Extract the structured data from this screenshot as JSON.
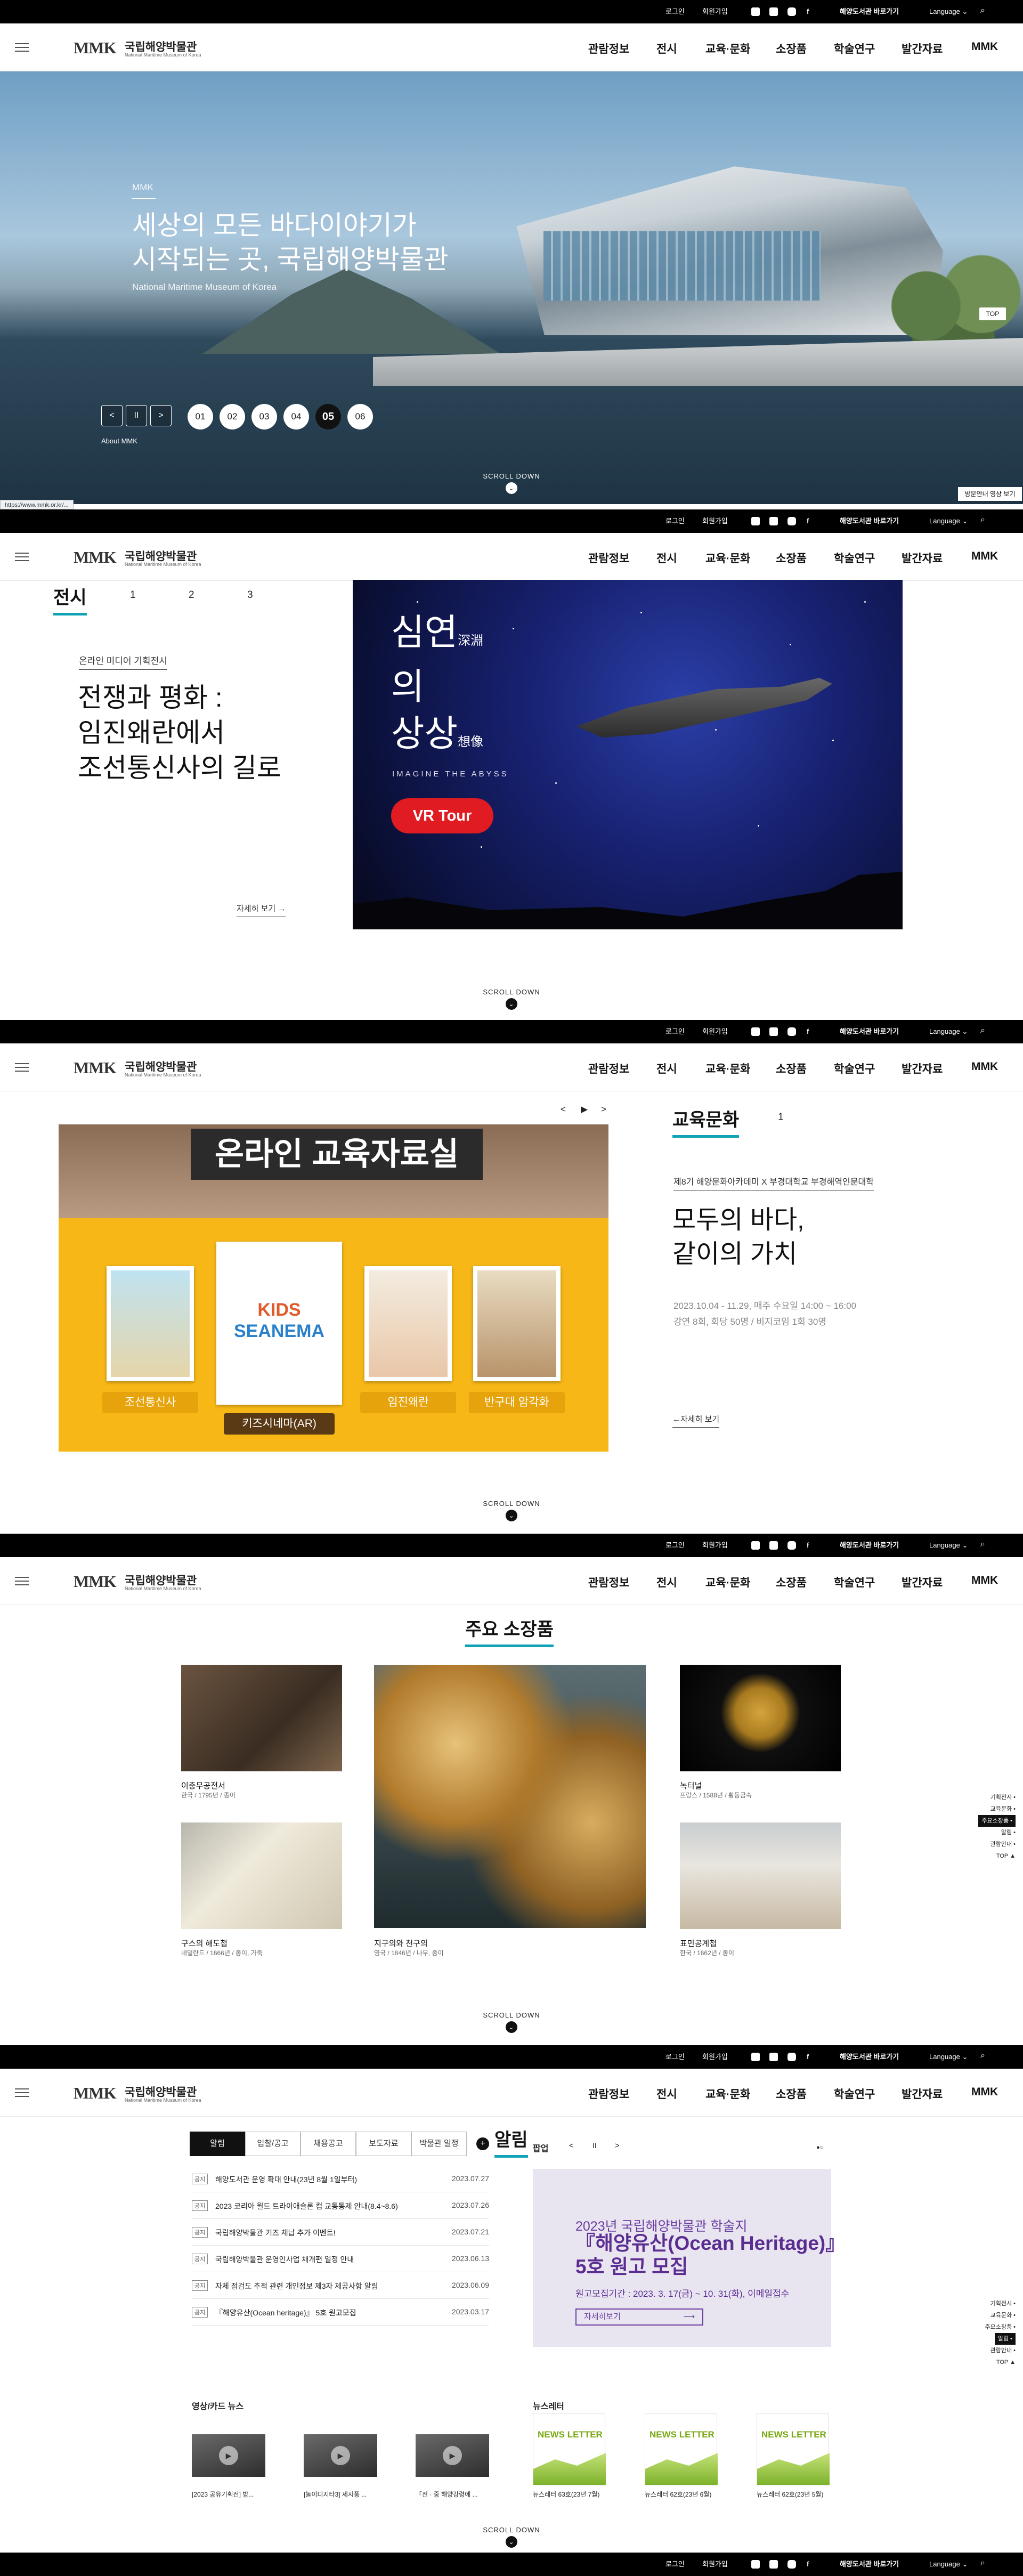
{
  "topbar": {
    "login": "로그인",
    "join": "회원가입",
    "library": "해양도서관 바로가기",
    "language": "Language"
  },
  "logo": {
    "mark": "MMK",
    "name_kr": "국립해양박물관",
    "name_en": "National Maritime Museum of Korea"
  },
  "menu": [
    "관람정보",
    "전시",
    "교육·문화",
    "소장품",
    "학술연구",
    "발간자료",
    "MMK"
  ],
  "hero": {
    "label": "MMK",
    "title_line1": "세상의 모든 바다이야기가",
    "title_line2": "시작되는 곳, 국립해양박물관",
    "subtitle": "National Maritime Museum of Korea",
    "prev": "<",
    "pause": "II",
    "next": ">",
    "slides": [
      "01",
      "02",
      "03",
      "04",
      "05",
      "06"
    ],
    "active_slide": "05",
    "about": "About MMK",
    "top": "TOP",
    "download": "방문안내 영상 보기",
    "status_url": "https://www.mmk.or.kr/..."
  },
  "scroll_down": "SCROLL DOWN",
  "exhibition": {
    "title": "전시",
    "tabs": [
      "1",
      "2",
      "3"
    ],
    "category": "온라인 미디어 기획전시",
    "title_line1": "전쟁과 평화 :",
    "title_line2": "임진왜란에서",
    "title_line3": "조선통신사의 길로",
    "more": "자세히 보기 →",
    "slider_prev": "<",
    "slider_play": "▶",
    "slider_next": ">",
    "poster_line1": "심연",
    "poster_hanja1": "深淵",
    "poster_line2": "의",
    "poster_line3": "상상",
    "poster_hanja2": "想像",
    "poster_en": "IMAGINE THE ABYSS",
    "vr_button": "VR Tour"
  },
  "education": {
    "title": "교육문화",
    "tab": "1",
    "slider_prev": "<",
    "slider_play": "▶",
    "slider_next": ">",
    "banner_title": "온라인 교육자료실",
    "banner_buttons": [
      "조선통신사",
      "키즈시네마(AR)",
      "임진왜란",
      "반구대 암각화"
    ],
    "kids_logo_line1": "KIDS",
    "kids_logo_line2": "SEANEMA",
    "category": "제8기 해양문화아카데미 X 부경대학교 부경해역인문대학",
    "title_line1": "모두의 바다,",
    "title_line2": "같이의 가치",
    "date": "2023.10.04 - 11.29, 매주 수요일 14:00 ~ 16:00",
    "detail": "강연 8회, 회당 50명 / 비지코임 1회 30명",
    "more": "←자세히 보기"
  },
  "collection": {
    "title": "주요 소장품",
    "items": [
      {
        "name": "이충무공전서",
        "desc": "한국 / 1795년 / 종이"
      },
      {
        "name": "구스의 해도첩",
        "desc": "네덜란드 / 1666년 / 종이, 가죽"
      },
      {
        "name": "지구의와 천구의",
        "desc": "영국 / 1846년 / 나무, 종이"
      },
      {
        "name": "녹터널",
        "desc": "프랑스 / 1588년 / 황동금속"
      },
      {
        "name": "표민공계첩",
        "desc": "한국 / 1662년 / 종이"
      }
    ]
  },
  "quick_nav": [
    "기획전시",
    "교육문화",
    "주요소장품",
    "알림",
    "관람안내",
    "TOP"
  ],
  "notice": {
    "title": "알림",
    "tabs": [
      "알림",
      "입찰/공고",
      "채용공고",
      "보도자료",
      "박물관 일정"
    ],
    "more": "+",
    "items": [
      {
        "tag": "공지",
        "text": "해양도서관 운영 확대 안내(23년 8월 1일부터)",
        "date": "2023.07.27"
      },
      {
        "tag": "공지",
        "text": "2023 코리아 월드 트라이애슬론 컵 교통통제 안내(8.4~8.6)",
        "date": "2023.07.26"
      },
      {
        "tag": "공지",
        "text": "국립해양박물관 키즈 체납 추가 이벤트!",
        "date": "2023.07.21"
      },
      {
        "tag": "공지",
        "text": "국립해양박물관 운영인사업 채개편 일정 안내",
        "date": "2023.06.13"
      },
      {
        "tag": "공지",
        "text": "자체 점검도 추적 관련 개인정보 제3자 제공사항 알림",
        "date": "2023.06.09"
      },
      {
        "tag": "공지",
        "text": "『해양유산(Ocean heritage)』 5호 원고모집",
        "date": "2023.03.17"
      }
    ],
    "popup_title": "팝업",
    "popup_prev": "<",
    "popup_pause": "II",
    "popup_next": ">",
    "popup_line1": "2023년 국립해양박물관 학술지",
    "popup_line2": "『해양유산(Ocean Heritage)』",
    "popup_line3": "5호 원고 모집",
    "popup_period": "원고모집기간 : 2023. 3. 17(금) ~ 10. 31(화), 이메일접수",
    "popup_button": "자세히보기",
    "video_title": "영상/카드 뉴스",
    "videos": [
      "[2023 공유기획전] 방...",
      "[놀이디지타3] 세시풍 ...",
      "「전 · 중 해양강령에 ..."
    ],
    "newsletter_title": "뉴스레터",
    "newsletter_label": "NEWS LETTER",
    "newsletters": [
      "뉴스레터 63호(23년 7월)",
      "뉴스레터 62호(23년 6월)",
      "뉴스레터 62호(23년 5월)"
    ]
  },
  "colors": {
    "accent": "#0fa3b5",
    "dark": "#111111",
    "popup_purple": "#5b2d91"
  }
}
